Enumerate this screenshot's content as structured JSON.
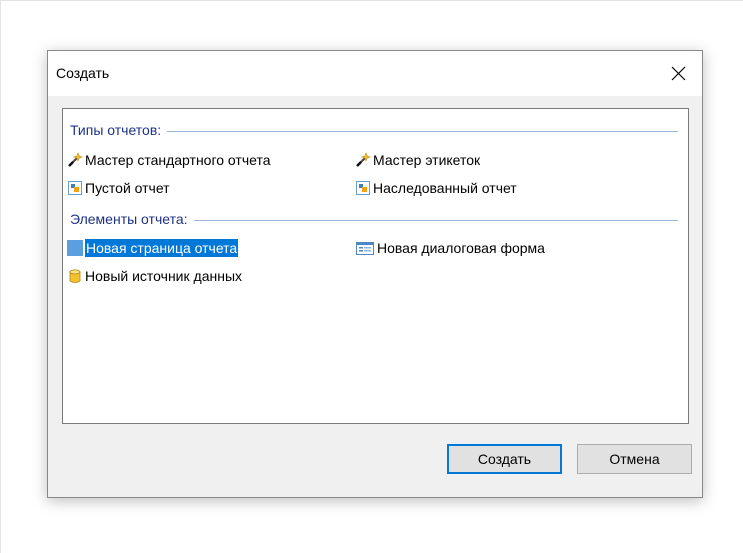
{
  "dialog": {
    "title": "Создать",
    "close_glyph": "✕"
  },
  "groups": [
    {
      "label": "Типы отчетов:",
      "items": [
        {
          "label": "Мастер стандартного отчета",
          "icon": "magic-wand-icon"
        },
        {
          "label": "Мастер этикеток",
          "icon": "magic-wand-icon"
        },
        {
          "label": "Пустой отчет",
          "icon": "report-icon"
        },
        {
          "label": "Наследованный отчет",
          "icon": "report-icon"
        }
      ]
    },
    {
      "label": "Элементы отчета:",
      "items": [
        {
          "label": "Новая страница отчета",
          "icon": "page-icon",
          "selected": true
        },
        {
          "label": "Новая диалоговая форма",
          "icon": "dialog-form-icon"
        },
        {
          "label": "Новый источник данных",
          "icon": "database-icon"
        }
      ]
    }
  ],
  "buttons": {
    "create": "Создать",
    "cancel": "Отмена"
  },
  "colors": {
    "selection": "#0078d7",
    "group_header_text": "#1e3287",
    "group_line": "#9bb4d4"
  }
}
